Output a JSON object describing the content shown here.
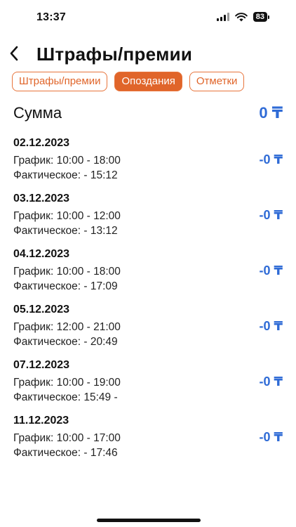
{
  "status_bar": {
    "time": "13:37",
    "battery": "83"
  },
  "header": {
    "title": "Штрафы/премии"
  },
  "tabs": [
    {
      "label": "Штрафы/премии",
      "active": false
    },
    {
      "label": "Опоздания",
      "active": true
    },
    {
      "label": "Отметки",
      "active": false
    }
  ],
  "summary": {
    "label": "Сумма",
    "value": "0 ₸"
  },
  "records": [
    {
      "date": "02.12.2023",
      "schedule": "График: 10:00 - 18:00",
      "actual": "Фактическое:  - 15:12",
      "amount": "-0 ₸"
    },
    {
      "date": "03.12.2023",
      "schedule": "График: 10:00 - 12:00",
      "actual": "Фактическое:  - 13:12",
      "amount": "-0 ₸"
    },
    {
      "date": "04.12.2023",
      "schedule": "График: 10:00 - 18:00",
      "actual": "Фактическое:  - 17:09",
      "amount": "-0 ₸"
    },
    {
      "date": "05.12.2023",
      "schedule": "График: 12:00 - 21:00",
      "actual": "Фактическое:  - 20:49",
      "amount": "-0 ₸"
    },
    {
      "date": "07.12.2023",
      "schedule": "График: 10:00 - 19:00",
      "actual": "Фактическое: 15:49 -",
      "amount": "-0 ₸"
    },
    {
      "date": "11.12.2023",
      "schedule": "График: 10:00 - 17:00",
      "actual": "Фактическое:  - 17:46",
      "amount": "-0 ₸"
    }
  ],
  "colors": {
    "accent_orange": "#e0652a",
    "amount_blue": "#2f6bd6"
  }
}
